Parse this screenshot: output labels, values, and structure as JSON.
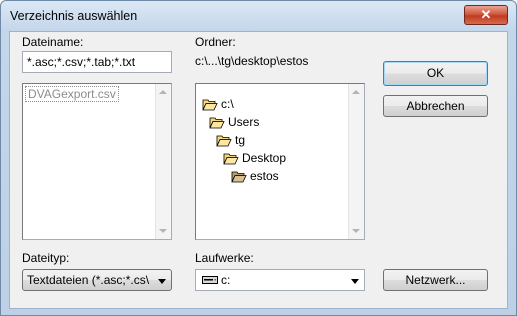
{
  "window": {
    "title": "Verzeichnis auswählen",
    "close_glyph": "✕"
  },
  "filename": {
    "label": "Dateiname:",
    "value": "*.asc;*.csv;*.tab;*.txt",
    "files": [
      "DVAGexport.csv"
    ]
  },
  "folder": {
    "label": "Ordner:",
    "path": "c:\\...\\tg\\desktop\\estos",
    "tree": [
      {
        "name": "c:\\",
        "icon": "open-folder-icon"
      },
      {
        "name": "Users",
        "icon": "open-folder-icon"
      },
      {
        "name": "tg",
        "icon": "open-folder-icon"
      },
      {
        "name": "Desktop",
        "icon": "open-folder-icon"
      },
      {
        "name": "estos",
        "icon": "open-folder-icon"
      }
    ]
  },
  "buttons": {
    "ok": "OK",
    "cancel": "Abbrechen",
    "network": "Netzwerk..."
  },
  "filetype": {
    "label": "Dateityp:",
    "value": "Textdateien (*.asc;*.cs\\"
  },
  "drives": {
    "label": "Laufwerke:",
    "value": "c:",
    "icon": "drive-icon"
  }
}
